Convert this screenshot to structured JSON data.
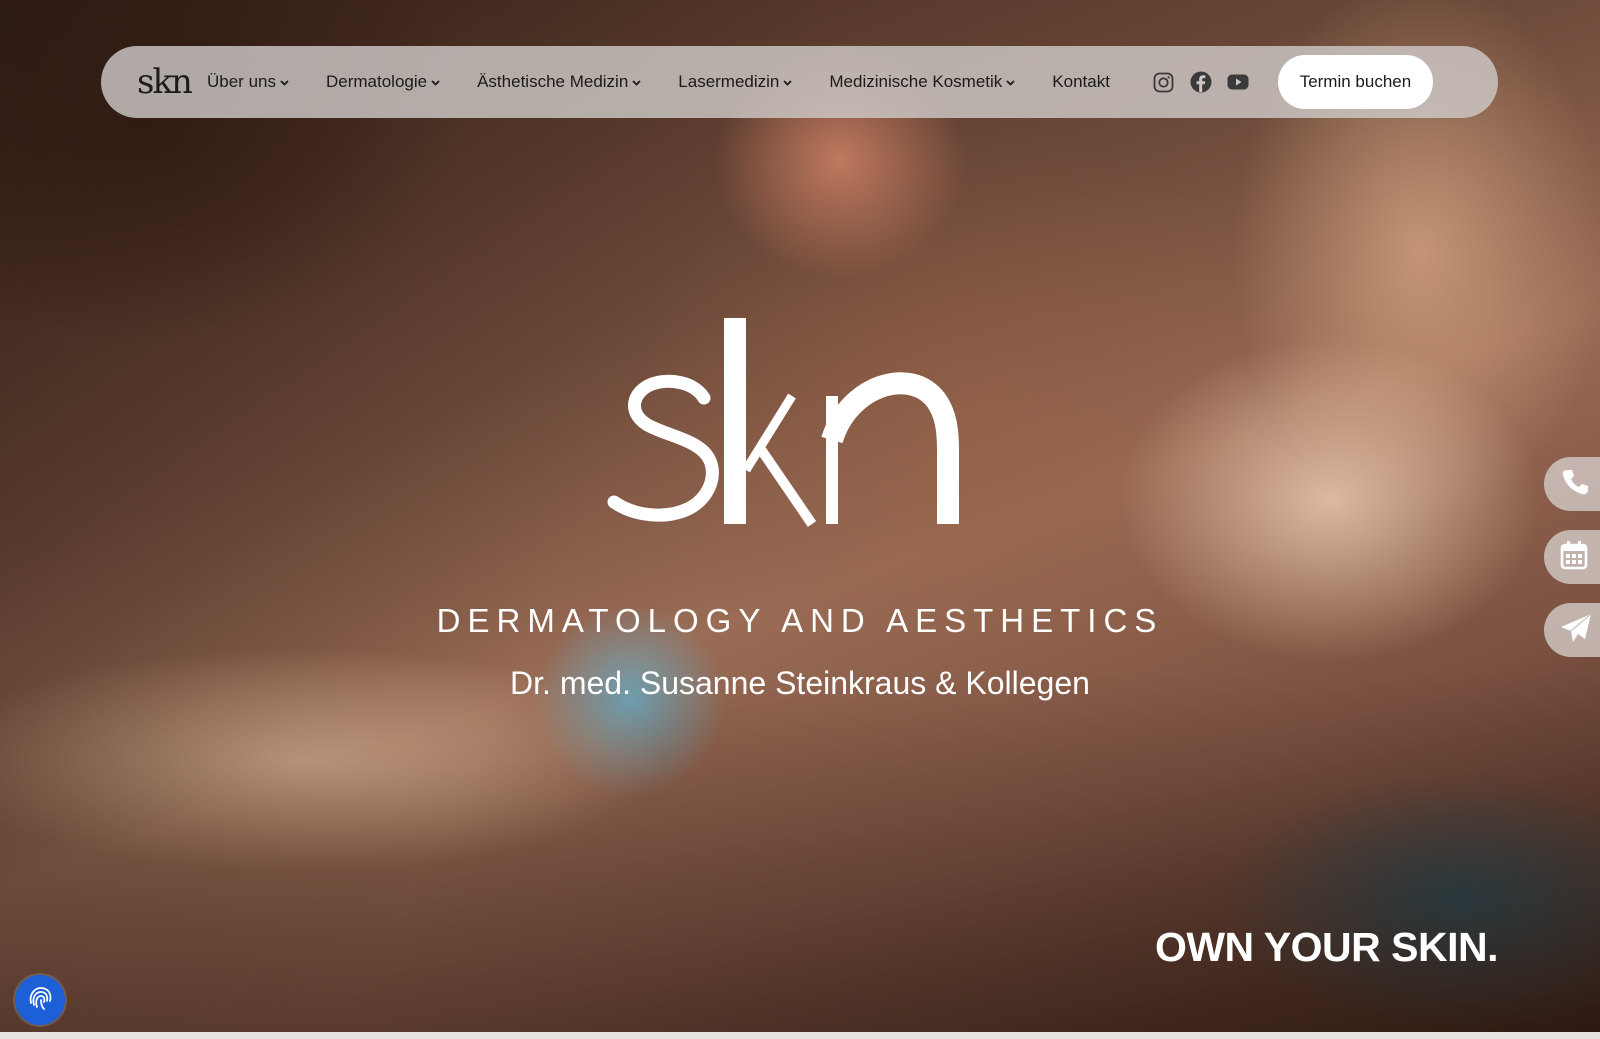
{
  "nav": {
    "logo": "skn",
    "items": [
      {
        "label": "Über uns",
        "has_dropdown": true
      },
      {
        "label": "Dermatologie",
        "has_dropdown": true
      },
      {
        "label": "Ästhetische Medizin",
        "has_dropdown": true
      },
      {
        "label": "Lasermedizin",
        "has_dropdown": true
      },
      {
        "label": "Medizinische Kosmetik",
        "has_dropdown": true
      },
      {
        "label": "Kontakt",
        "has_dropdown": false
      }
    ],
    "socials": [
      "instagram-icon",
      "facebook-icon",
      "youtube-icon"
    ],
    "cta_label": "Termin buchen"
  },
  "hero": {
    "brand": "skn",
    "tagline": "DERMATOLOGY AND AESTHETICS",
    "subline": "Dr. med. Susanne Steinkraus & Kollegen",
    "claim": "OWN YOUR SKIN."
  },
  "side_tabs": [
    "phone-icon",
    "calendar-icon",
    "paper-plane-icon"
  ],
  "privacy_button": "fingerprint-icon",
  "colors": {
    "cta_bg": "#ffffff",
    "nav_bg": "#cdc8c6",
    "privacy_button": "#1d5fd6",
    "text_light": "#ffffff"
  }
}
